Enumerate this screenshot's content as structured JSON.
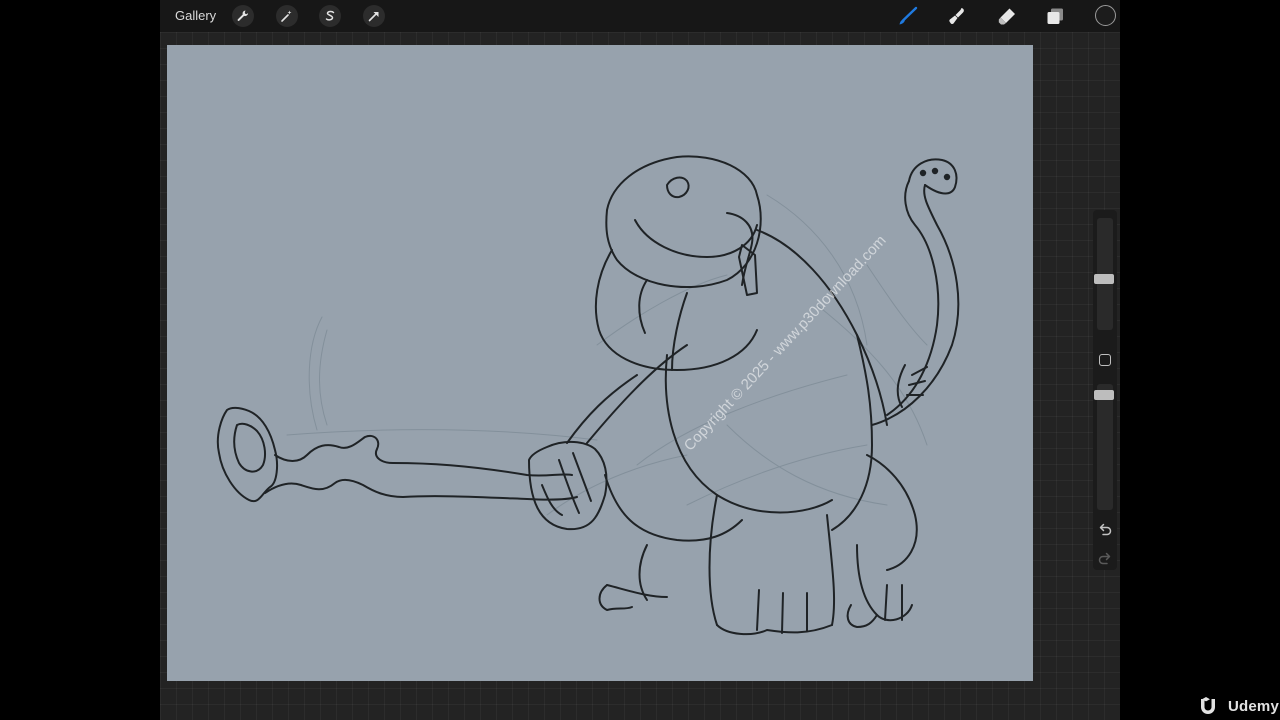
{
  "toolbar": {
    "gallery_label": "Gallery",
    "left_icons": [
      "wrench-icon",
      "magic-wand-icon",
      "selection-icon",
      "transform-arrow-icon"
    ],
    "right_icons": [
      "brush-icon",
      "smudge-icon",
      "eraser-icon",
      "layers-icon",
      "color-swatch"
    ],
    "active_color": "#1f7ae0"
  },
  "canvas": {
    "background_color": "#97a2ad",
    "overlay_text": "Copyright © 2025 - www.p30download.com"
  },
  "sidebar": {
    "brush_size_level": 0.55,
    "opacity_level": 0.95,
    "undo_icon": "undo-icon",
    "redo_icon": "redo-icon"
  },
  "watermark": {
    "text": "Udemy"
  }
}
